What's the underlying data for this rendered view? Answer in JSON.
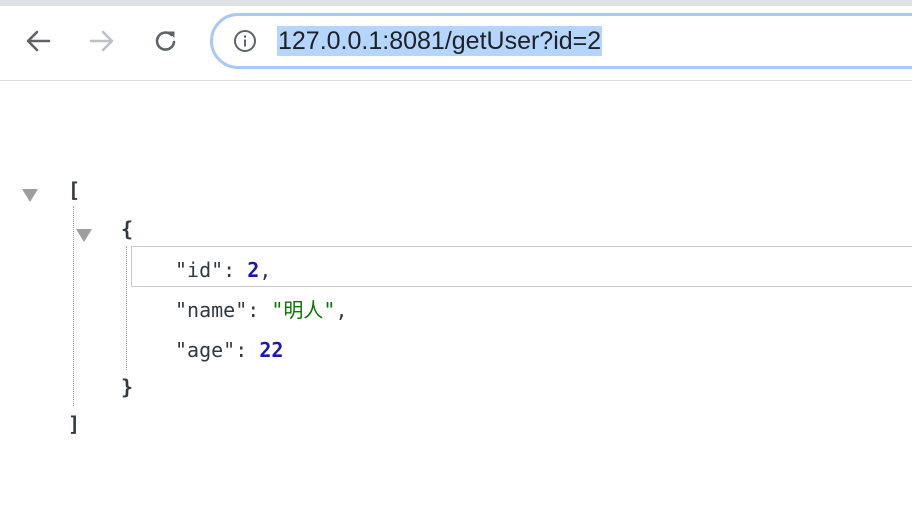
{
  "browser": {
    "back_icon": "arrow-left-icon",
    "forward_icon": "arrow-right-icon",
    "reload_icon": "reload-icon",
    "info_icon": "info-icon",
    "url": "127.0.0.1:8081/getUser?id=2"
  },
  "json_view": {
    "open_array": "[",
    "open_object": "{",
    "close_object": "}",
    "close_array": "]",
    "fields": [
      {
        "key": "\"id\"",
        "sep": ": ",
        "value": "2",
        "trail": ","
      },
      {
        "key": "\"name\"",
        "sep": ": ",
        "value": "\"明人\"",
        "trail": ","
      },
      {
        "key": "\"age\"",
        "sep": ": ",
        "value": "22",
        "trail": ""
      }
    ]
  }
}
